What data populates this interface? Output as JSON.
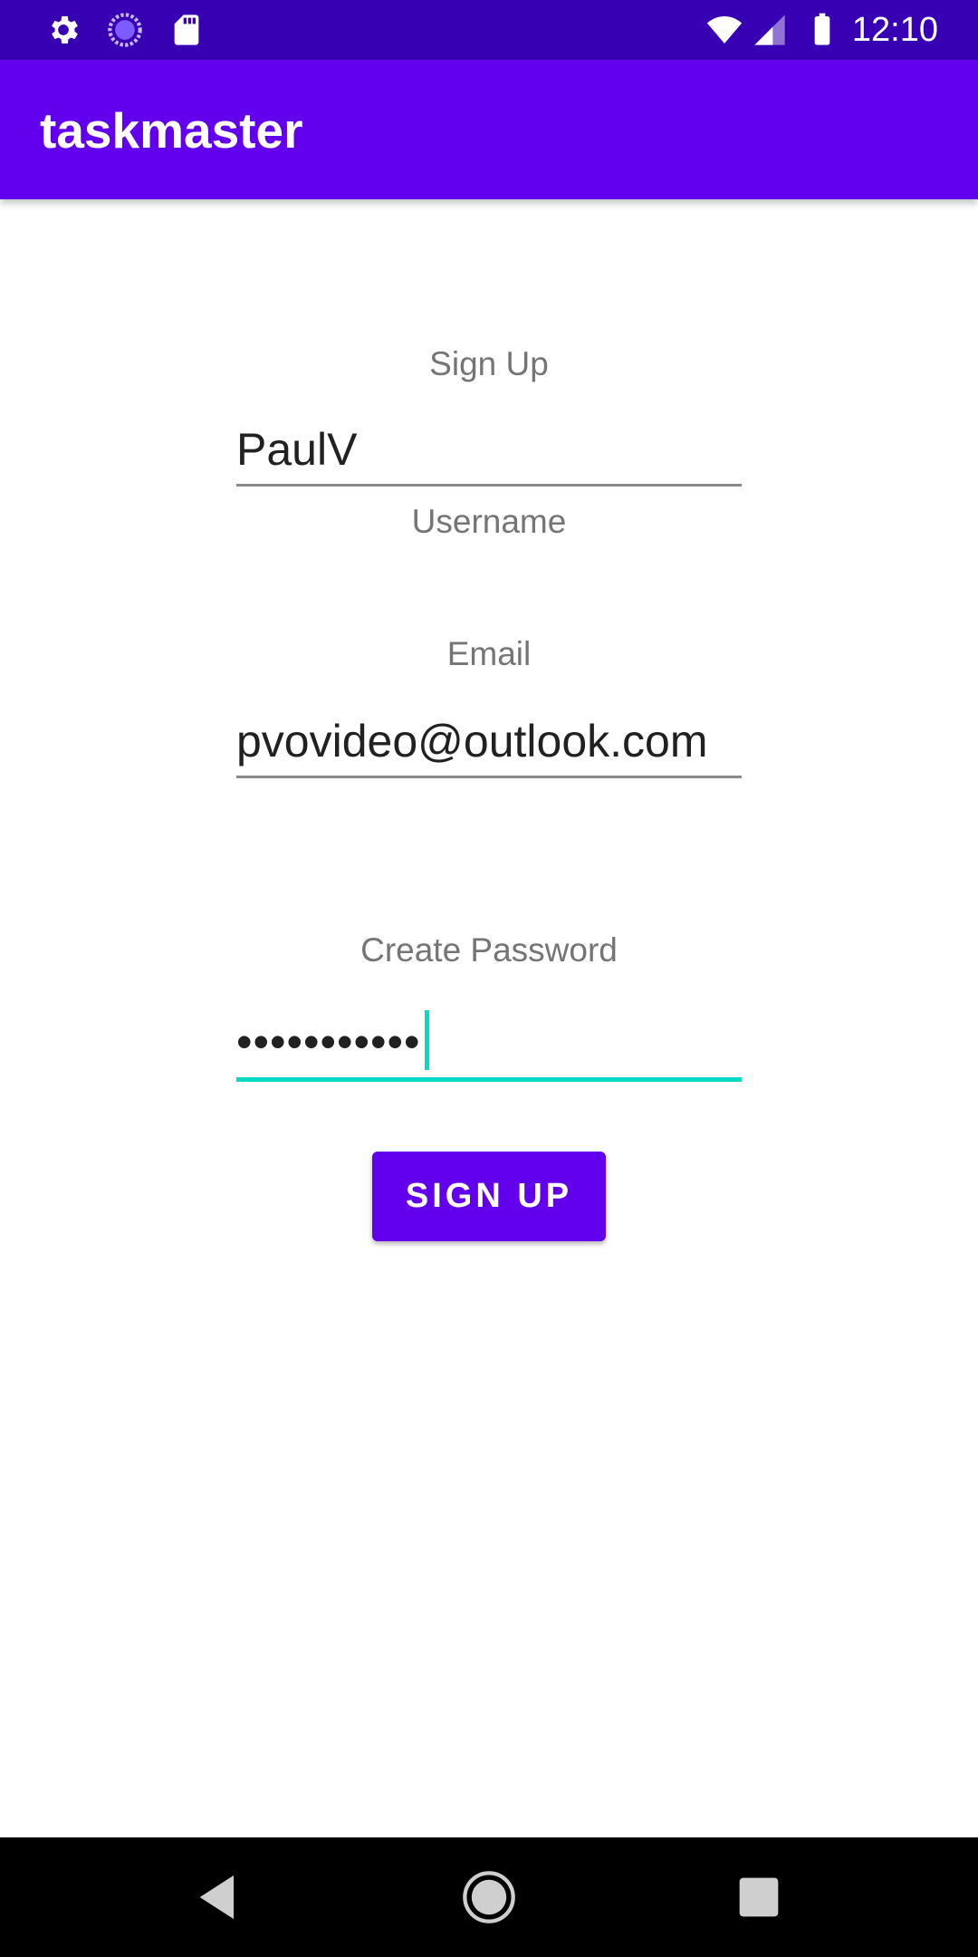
{
  "status_bar": {
    "time": "12:10",
    "icons": [
      "settings-icon",
      "sync-progress-icon",
      "sd-card-icon",
      "wifi-icon",
      "cellular-signal-icon",
      "battery-icon"
    ]
  },
  "app_bar": {
    "title": "taskmaster",
    "color": "#6200ee"
  },
  "form": {
    "heading": "Sign Up",
    "username": {
      "value": "PaulV",
      "label": "Username"
    },
    "email": {
      "label": "Email",
      "value": "pvovideo@outlook.com"
    },
    "password": {
      "label": "Create Password",
      "value": "•••••••••••"
    },
    "submit_label": "SIGN UP"
  },
  "nav_bar": {
    "buttons": [
      "back-icon",
      "home-icon",
      "recents-icon"
    ]
  },
  "colors": {
    "status_bar": "#3700b3",
    "primary": "#6200ee",
    "accent": "#03dac5"
  }
}
